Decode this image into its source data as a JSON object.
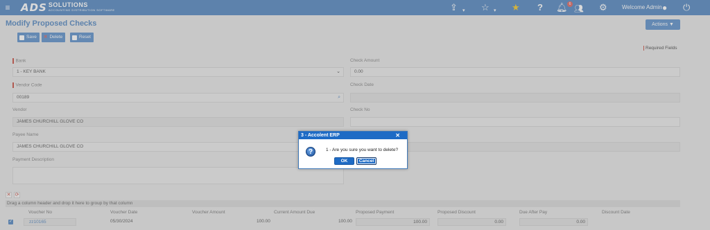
{
  "header": {
    "logo_mark": "ADS",
    "logo_name": "SOLUTIONS",
    "logo_tagline": "ACCOUNTING DISTRIBUTION SOFTWARE",
    "notifications_count": "6",
    "welcome_text": "Welcome Admin"
  },
  "page": {
    "title": "Modify Proposed Checks",
    "actions_label": "Actions ▼",
    "toolbar": {
      "save": "Save",
      "delete": "Delete",
      "reset": "Reset"
    },
    "required_fields": "Required Fields"
  },
  "form": {
    "bank": {
      "label": "Bank",
      "value": "1 - KEY BANK"
    },
    "vendor_code": {
      "label": "Vendor Code",
      "value": "00189"
    },
    "vendor": {
      "label": "Vendor",
      "value": "JAMES CHURCHILL GLOVE CO"
    },
    "payee_name": {
      "label": "Payee Name",
      "value": "JAMES CHURCHILL GLOVE CO"
    },
    "payment_description": {
      "label": "Payment Description",
      "value": ""
    },
    "check_amount": {
      "label": "Check Amount",
      "value": "0.00"
    },
    "check_date": {
      "label": "Check Date",
      "value": ""
    },
    "check_no": {
      "label": "Check No",
      "value": ""
    }
  },
  "grid": {
    "group_hint": "Drag a column header and drop it here to group by that column",
    "columns": [
      "Voucher No",
      "Voucher Date",
      "Voucher Amount",
      "Current Amount Due",
      "Proposed Payment",
      "Proposed Discount",
      "Due After Pay",
      "Discount Date"
    ],
    "rows": [
      {
        "voucher_no": "zz10165",
        "voucher_date": "05/30/2024",
        "voucher_amount": "100.00",
        "current_due": "100.00",
        "proposed_payment": "100.00",
        "proposed_discount": "0.00",
        "due_after_pay": "0.00",
        "discount_date": ""
      }
    ]
  },
  "dialog": {
    "title": "3 - Accolent ERP",
    "message": "1 - Are you sure you want to delete?",
    "ok": "OK",
    "cancel": "Cancel"
  }
}
